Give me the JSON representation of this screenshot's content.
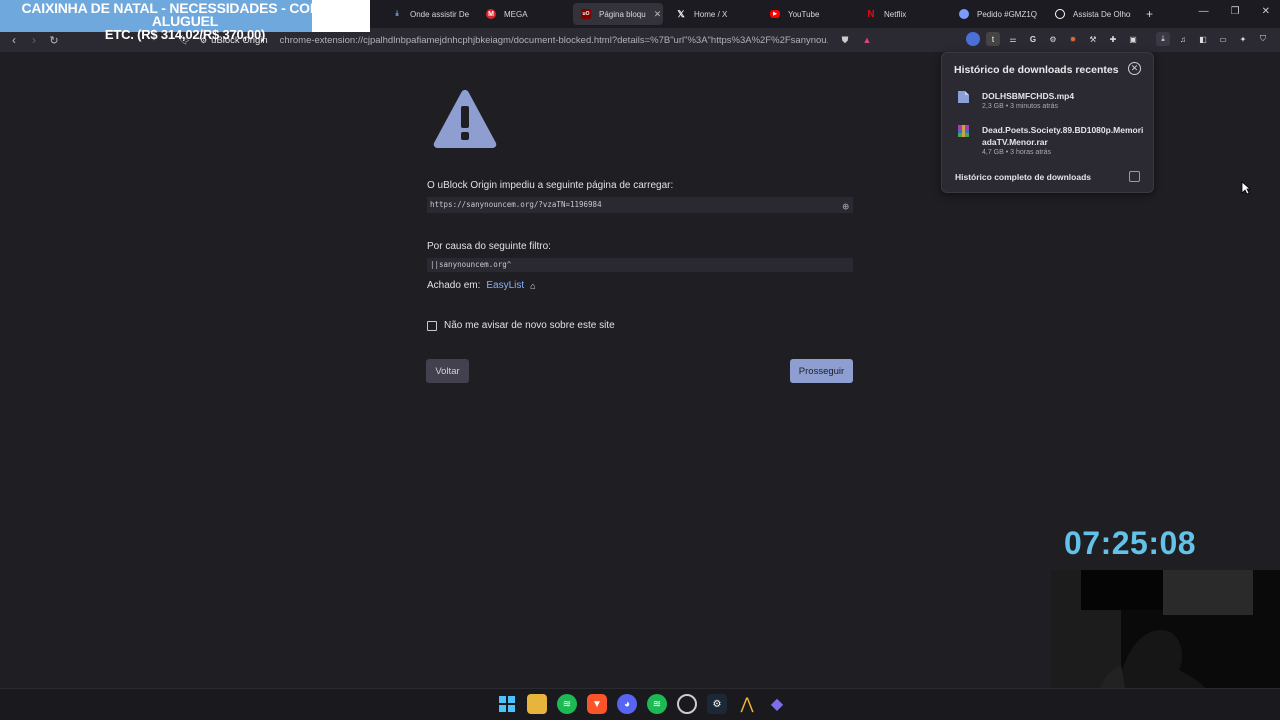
{
  "banner": {
    "line1": "CAIXINHA DE NATAL - NECESSIDADES - COMIDA, ALUGUEL",
    "line2": "ETC. (R$ 314,02/R$ 370,00)"
  },
  "tabs": [
    {
      "label": "Onde assistir De",
      "icon": "download-icon",
      "color": "#8ab4ff"
    },
    {
      "label": "MEGA",
      "icon": "mega-icon",
      "color": "#d9272e"
    },
    {
      "label": "Página bloqu",
      "icon": "ublock-icon",
      "color": "#800000",
      "active": true
    },
    {
      "label": "Home / X",
      "icon": "x-icon",
      "color": "#ffffff"
    },
    {
      "label": "YouTube",
      "icon": "youtube-icon",
      "color": "#ff0000"
    },
    {
      "label": "Netflix",
      "icon": "netflix-icon",
      "color": "#e50914"
    },
    {
      "label": "Pedido #GMZ1Q",
      "icon": "globe-icon",
      "color": "#7a9cff"
    },
    {
      "label": "Assista De Olhos",
      "icon": "site-icon",
      "color": "#ffffff"
    }
  ],
  "toolbar": {
    "origin": "uBlock Origin",
    "url": "chrome-extension://cjpalhdlnbpafiamejdnhcphjbkeiagm/document-blocked.html?details=%7B\"url\"%3A\"https%3A%2F%2Fsanynou..."
  },
  "page": {
    "blocked_label": "O uBlock Origin impediu a seguinte página de carregar:",
    "blocked_url": "https://sanynouncem.org/?vzaTN=1196984",
    "filter_label": "Por causa do seguinte filtro:",
    "filter": "||sanynouncem.org^",
    "found_label": "Achado em:",
    "found_list": "EasyList",
    "dont_warn": "Não me avisar de novo sobre este site",
    "back_button": "Voltar",
    "proceed_button": "Prosseguir"
  },
  "downloads": {
    "title": "Histórico de downloads recentes",
    "items": [
      {
        "name": "DOLHSBMFCHDS.mp4",
        "meta": "2,3 GB • 3 minutos atrás"
      },
      {
        "name_line1": "Dead.Poets.Society.89.BD1080p.Memori",
        "name_line2": "adaTV.Menor.rar",
        "meta": "4,7 GB • 3 horas atrás"
      }
    ],
    "footer": "Histórico completo de downloads"
  },
  "clock": "07:25:08",
  "colors": {
    "accent": "#8e9ed1",
    "link": "#86b1ff",
    "clock": "#62c2e8",
    "banner": "#6fa8dc"
  }
}
